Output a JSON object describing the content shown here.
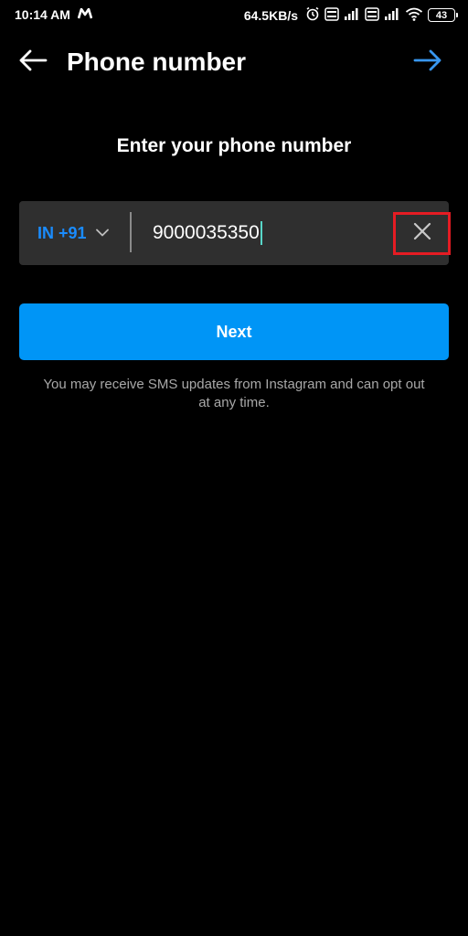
{
  "status_bar": {
    "time": "10:14 AM",
    "carrier_icon": "m-logo-icon",
    "speed": "64.5KB/s",
    "volte_label": "Vo\nLTE",
    "battery": "43"
  },
  "header": {
    "title": "Phone number"
  },
  "form": {
    "prompt": "Enter your phone number",
    "country_code": "IN +91",
    "phone_value": "9000035350",
    "next_label": "Next",
    "sms_note": "You may receive SMS updates from Instagram and can opt out at any time."
  },
  "colors": {
    "accent": "#0095f6",
    "country_code": "#1a8cff",
    "highlight_box": "#e51c23",
    "input_bg": "#2f2f2f"
  }
}
